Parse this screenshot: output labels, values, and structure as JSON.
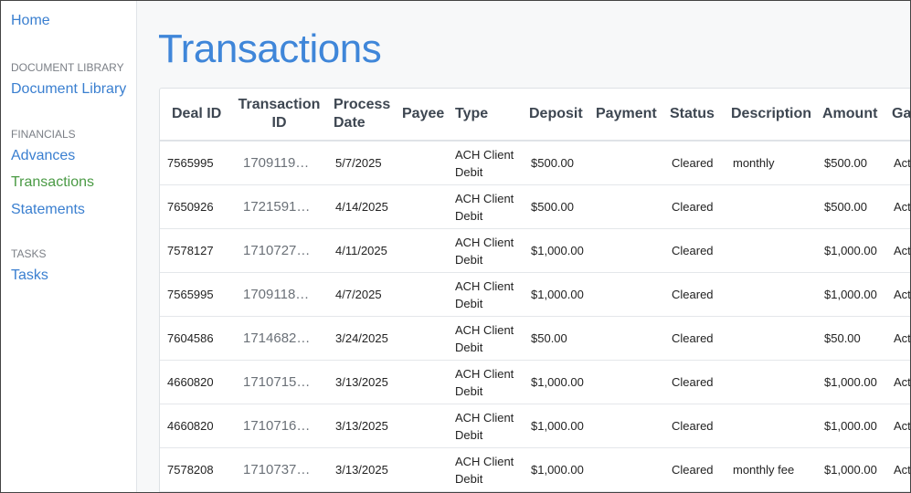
{
  "sidebar": {
    "home": "Home",
    "doc_header": "DOCUMENT LIBRARY",
    "doc_link": "Document Library",
    "fin_header": "FINANCIALS",
    "advances": "Advances",
    "transactions": "Transactions",
    "statements": "Statements",
    "tasks_header": "TASKS",
    "tasks": "Tasks"
  },
  "page": {
    "title": "Transactions"
  },
  "table": {
    "headers": {
      "deal_id": "Deal ID",
      "transaction_id": "Transaction ID",
      "process_date": "Process Date",
      "payee": "Payee",
      "type": "Type",
      "deposit": "Deposit",
      "payment": "Payment",
      "status": "Status",
      "description": "Description",
      "amount": "Amount",
      "ga": "Ga"
    },
    "rows": [
      {
        "deal_id": "7565995",
        "transaction_id": "1709119…",
        "process_date": "5/7/2025",
        "payee": "",
        "type": "ACH Client Debit",
        "deposit": "$500.00",
        "payment": "",
        "status": "Cleared",
        "description": "monthly",
        "amount": "$500.00",
        "ga": "Act"
      },
      {
        "deal_id": "7650926",
        "transaction_id": "1721591…",
        "process_date": "4/14/2025",
        "payee": "",
        "type": "ACH Client Debit",
        "deposit": "$500.00",
        "payment": "",
        "status": "Cleared",
        "description": "",
        "amount": "$500.00",
        "ga": "Act"
      },
      {
        "deal_id": "7578127",
        "transaction_id": "1710727…",
        "process_date": "4/11/2025",
        "payee": "",
        "type": "ACH Client Debit",
        "deposit": "$1,000.00",
        "payment": "",
        "status": "Cleared",
        "description": "",
        "amount": "$1,000.00",
        "ga": "Act"
      },
      {
        "deal_id": "7565995",
        "transaction_id": "1709118…",
        "process_date": "4/7/2025",
        "payee": "",
        "type": "ACH Client Debit",
        "deposit": "$1,000.00",
        "payment": "",
        "status": "Cleared",
        "description": "",
        "amount": "$1,000.00",
        "ga": "Act"
      },
      {
        "deal_id": "7604586",
        "transaction_id": "1714682…",
        "process_date": "3/24/2025",
        "payee": "",
        "type": "ACH Client Debit",
        "deposit": "$50.00",
        "payment": "",
        "status": "Cleared",
        "description": "",
        "amount": "$50.00",
        "ga": "Act"
      },
      {
        "deal_id": "4660820",
        "transaction_id": "1710715…",
        "process_date": "3/13/2025",
        "payee": "",
        "type": "ACH Client Debit",
        "deposit": "$1,000.00",
        "payment": "",
        "status": "Cleared",
        "description": "",
        "amount": "$1,000.00",
        "ga": "Act"
      },
      {
        "deal_id": "4660820",
        "transaction_id": "1710716…",
        "process_date": "3/13/2025",
        "payee": "",
        "type": "ACH Client Debit",
        "deposit": "$1,000.00",
        "payment": "",
        "status": "Cleared",
        "description": "",
        "amount": "$1,000.00",
        "ga": "Act"
      },
      {
        "deal_id": "7578208",
        "transaction_id": "1710737…",
        "process_date": "3/13/2025",
        "payee": "",
        "type": "ACH Client Debit",
        "deposit": "$1,000.00",
        "payment": "",
        "status": "Cleared",
        "description": "monthly fee",
        "amount": "$1,000.00",
        "ga": "Act"
      }
    ]
  },
  "colors": {
    "link": "#3a7fd0",
    "active_link": "#4a9a44",
    "title": "#3f86d9",
    "section_header": "#7b7f86",
    "table_header_text": "#3d4651",
    "main_background": "#f7f8f9"
  }
}
